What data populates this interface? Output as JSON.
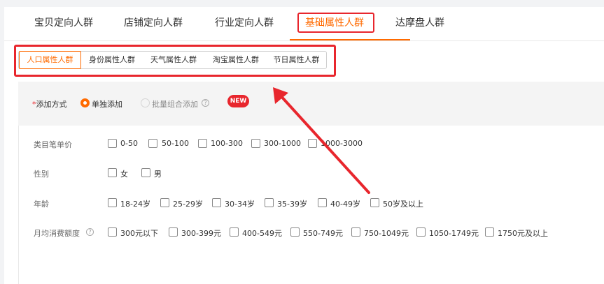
{
  "top_tabs": [
    {
      "label": "宝贝定向人群"
    },
    {
      "label": "店铺定向人群"
    },
    {
      "label": "行业定向人群"
    },
    {
      "label": "基础属性人群"
    },
    {
      "label": "达摩盘人群"
    }
  ],
  "sub_tabs": [
    {
      "label": "人口属性人群"
    },
    {
      "label": "身份属性人群"
    },
    {
      "label": "天气属性人群"
    },
    {
      "label": "淘宝属性人群"
    },
    {
      "label": "节日属性人群"
    }
  ],
  "add_method": {
    "required_mark": "*",
    "label": "添加方式",
    "option_single": "单独添加",
    "option_batch": "批量组合添加",
    "help_glyph": "?",
    "new_badge": "NEW",
    "selected": "单独添加"
  },
  "rows": {
    "price": {
      "label": "类目笔单价",
      "options": [
        "0-50",
        "50-100",
        "100-300",
        "300-1000",
        "1000-3000"
      ]
    },
    "gender": {
      "label": "性别",
      "options": [
        "女",
        "男"
      ]
    },
    "age": {
      "label": "年龄",
      "options": [
        "18-24岁",
        "25-29岁",
        "30-34岁",
        "35-39岁",
        "40-49岁",
        "50岁及以上"
      ]
    },
    "spend": {
      "label": "月均消费额度",
      "help_glyph": "?",
      "options": [
        "300元以下",
        "300-399元",
        "400-549元",
        "550-749元",
        "750-1049元",
        "1050-1749元",
        "1750元及以上"
      ]
    }
  },
  "colors": {
    "accent": "#ff6a00",
    "annotation": "#e8262d"
  }
}
